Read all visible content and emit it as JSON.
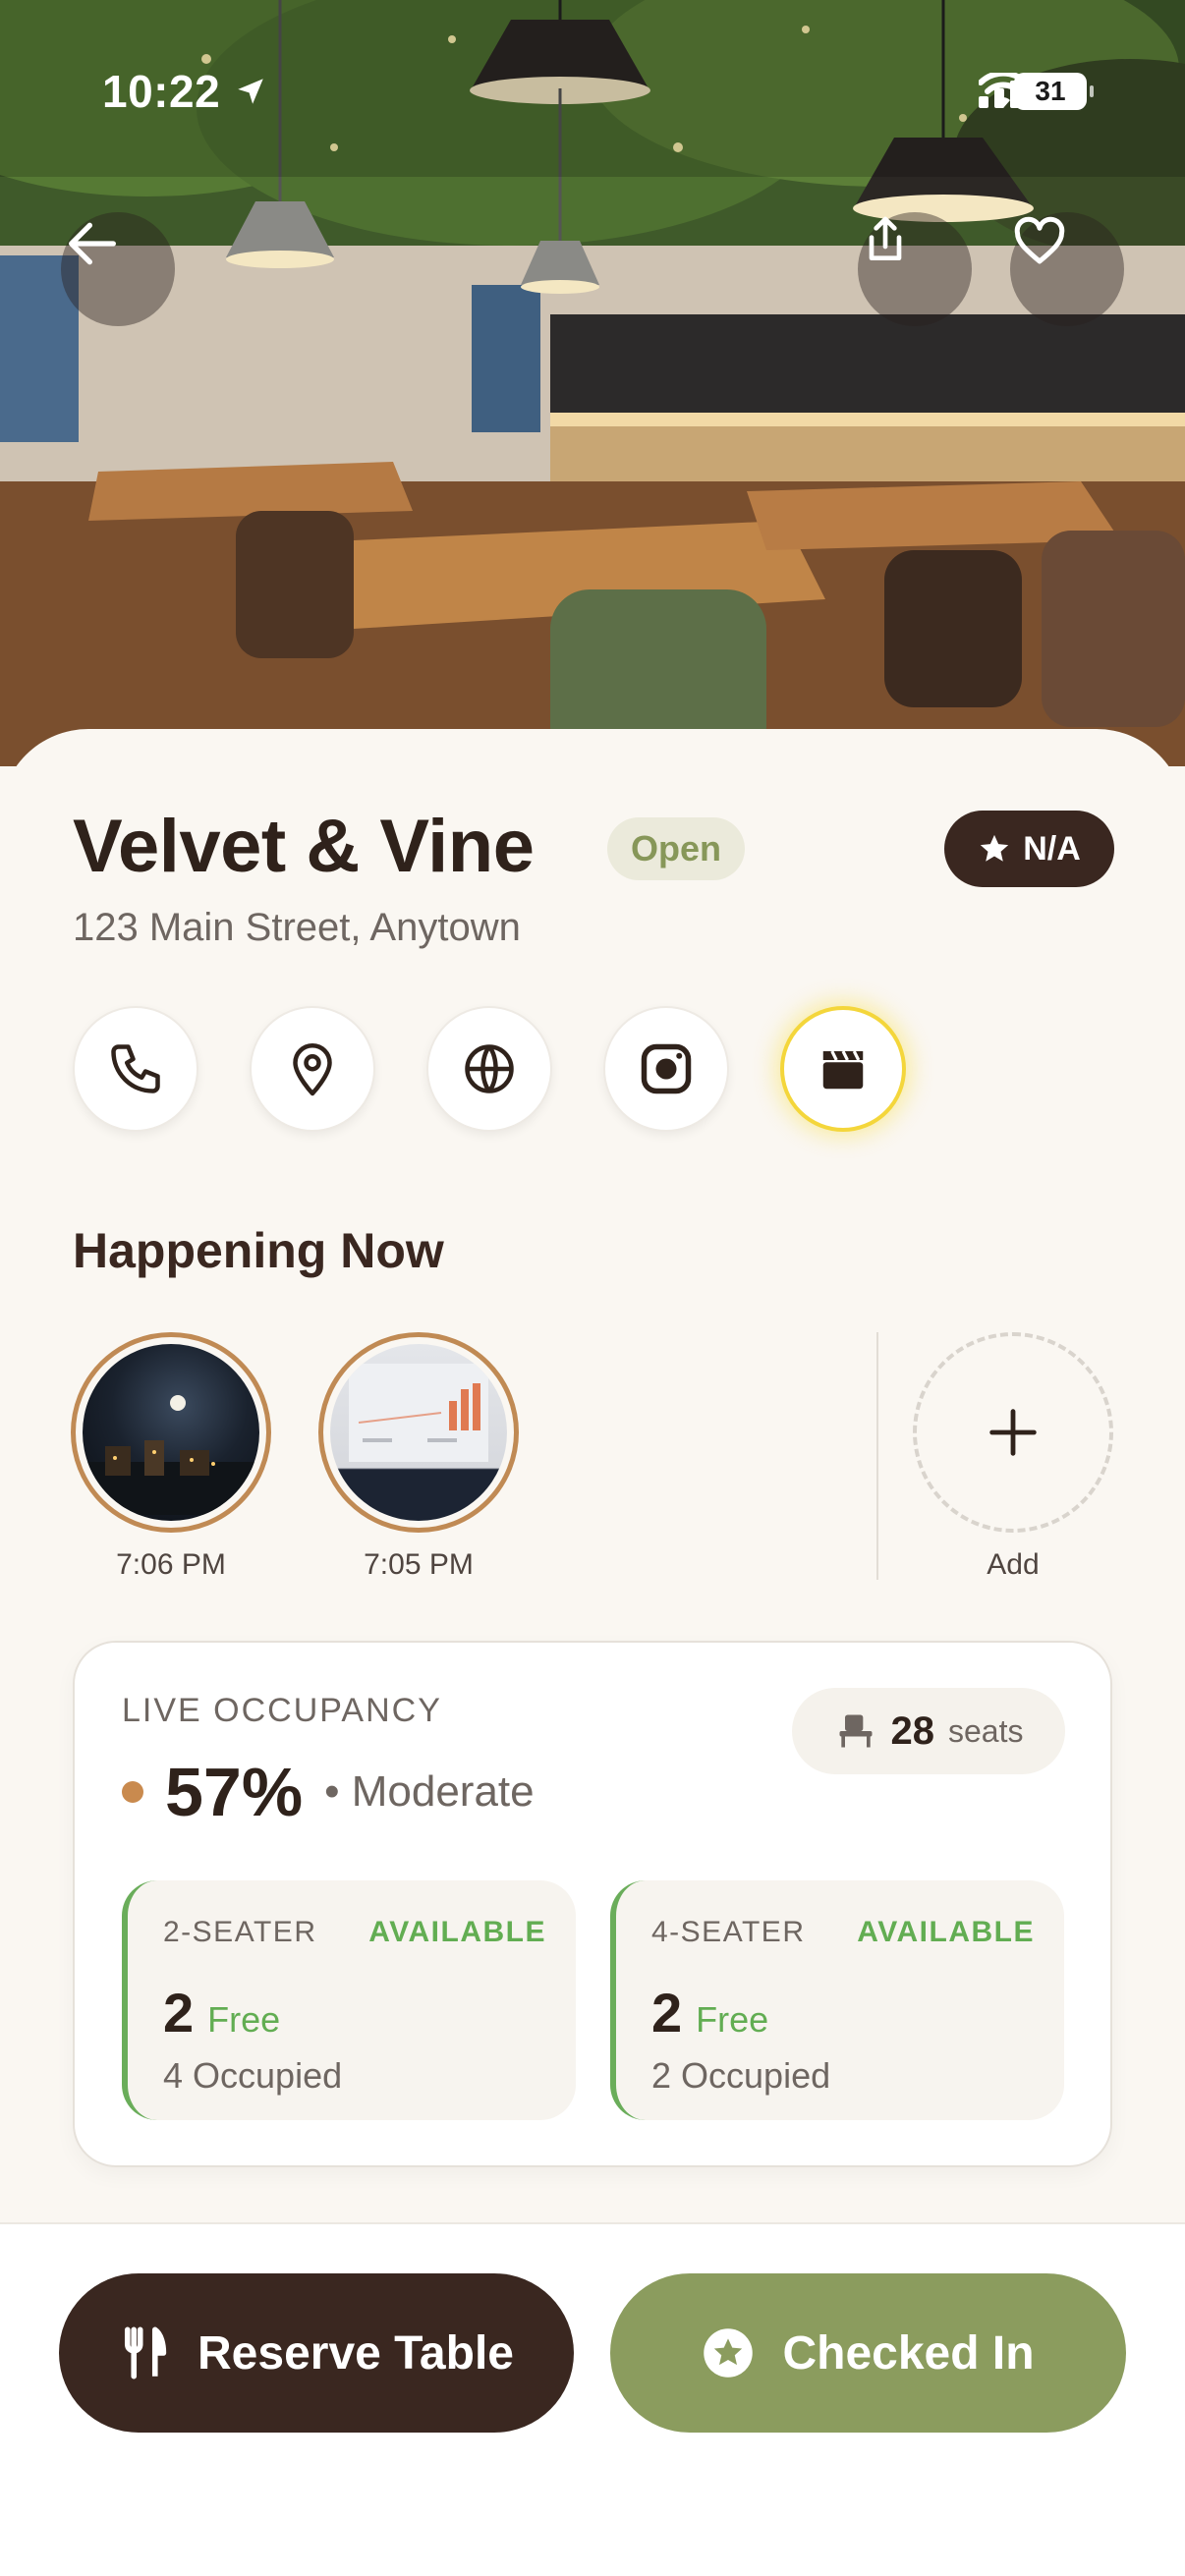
{
  "status_bar": {
    "time": "10:22",
    "battery": "31"
  },
  "hero": {
    "image": "restaurant-interior-photo",
    "icons": {
      "back": "back-arrow-icon",
      "share": "share-icon",
      "favorite": "heart-icon"
    }
  },
  "venue": {
    "name": "Velvet & Vine",
    "status": "Open",
    "rating": "N/A",
    "address": "123 Main Street, Anytown"
  },
  "actions": [
    {
      "icon": "phone-icon"
    },
    {
      "icon": "location-pin-icon"
    },
    {
      "icon": "globe-icon"
    },
    {
      "icon": "instagram-icon"
    },
    {
      "icon": "clapperboard-icon"
    }
  ],
  "happening_now": {
    "title": "Happening Now",
    "stories": [
      {
        "time": "7:06 PM"
      },
      {
        "time": "7:05 PM"
      }
    ],
    "add_label": "Add"
  },
  "occupancy": {
    "label": "LIVE OCCUPANCY",
    "percent": "57%",
    "level": "• Moderate",
    "seats_count": "28",
    "seats_unit": "seats",
    "tables": [
      {
        "type": "2-SEATER",
        "status": "AVAILABLE",
        "free": "2",
        "free_label": "Free",
        "occupied": "4 Occupied"
      },
      {
        "type": "4-SEATER",
        "status": "AVAILABLE",
        "free": "2",
        "free_label": "Free",
        "occupied": "2 Occupied"
      }
    ]
  },
  "buttons": {
    "reserve": "Reserve Table",
    "checked_in": "Checked In"
  },
  "colors": {
    "brown": "#3a2720",
    "olive": "#8b9c5e",
    "green": "#62ad52",
    "amber": "#c98a4e",
    "highlight": "#f4d63b"
  }
}
